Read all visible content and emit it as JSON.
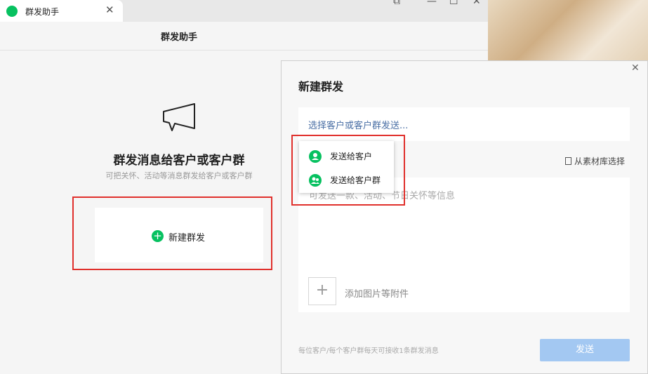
{
  "tab": {
    "title": "群发助手",
    "icon": "chat-bubble-icon",
    "close": "✕"
  },
  "window_controls": {
    "pin": "⧉",
    "minimize": "—",
    "maximize": "☐",
    "close": "✕"
  },
  "header": {
    "title": "群发助手"
  },
  "hero": {
    "icon": "megaphone-icon",
    "title": "群发消息给客户或客户群",
    "subtitle": "可把关怀、活动等消息群发给客户或客户群"
  },
  "new_button": {
    "label": "新建群发",
    "icon": "+"
  },
  "modal": {
    "title": "新建群发",
    "close": "✕",
    "select_placeholder": "选择客户或客户群发送...",
    "library_link": "从素材库选择",
    "message_placeholder": "可发送一款、活动、节日关怀等信息",
    "attach_icon": "+",
    "attach_label": "添加图片等附件",
    "footnote": "每位客户/每个客户群每天可接收1条群发消息",
    "send_label": "发送"
  },
  "dropdown": {
    "items": [
      {
        "label": "发送给客户",
        "icon": "user-icon"
      },
      {
        "label": "发送给客户群",
        "icon": "group-icon"
      }
    ]
  },
  "colors": {
    "brand_green": "#07c160",
    "highlight_red": "#e0302c",
    "send_disabled": "#a3c8f2",
    "link_blue": "#4a6fa5"
  }
}
